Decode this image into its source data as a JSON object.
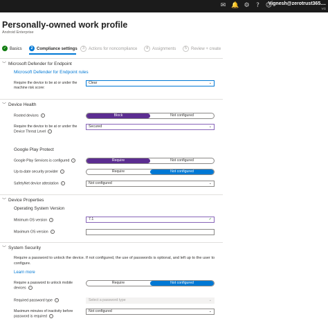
{
  "topbar": {
    "user_name": "Vignesh@zerotrust365....",
    "tenant_initials": "VG",
    "icons": [
      "mail-icon",
      "bell-icon",
      "gear-icon",
      "help-icon",
      "feedback-icon"
    ]
  },
  "page": {
    "title": "Personally-owned work profile",
    "more": "···",
    "subtitle": "Android Enterprise"
  },
  "wizard": {
    "steps": [
      {
        "num": "✓",
        "label": "Basics"
      },
      {
        "num": "2",
        "label": "Compliance settings"
      },
      {
        "num": "3",
        "label": "Actions for noncompliance"
      },
      {
        "num": "4",
        "label": "Assignments"
      },
      {
        "num": "5",
        "label": "Review + create"
      }
    ]
  },
  "mde": {
    "header": "Microsoft Defender for Endpoint",
    "rules_label": "Microsoft Defender for Endpoint rules",
    "risk_label": "Require the device to be at or under the machine risk score:",
    "risk_value": "Clear"
  },
  "health": {
    "header": "Device Health",
    "rooted_label": "Rooted devices",
    "rooted_left": "Block",
    "rooted_right": "Not configured",
    "threat_label": "Require the device to be at or under the Device Threat Level",
    "threat_value": "Secured",
    "gpp_header": "Google Play Protect",
    "gps_label": "Google Play Services is configured",
    "gps_left": "Require",
    "gps_right": "Not configured",
    "usp_label": "Up-to-date security provider",
    "usp_left": "Require",
    "usp_right": "Not configured",
    "safetynet_label": "SafetyNet device attestation",
    "safetynet_value": "Not configured"
  },
  "props": {
    "header": "Device Properties",
    "os_header": "Operating System Version",
    "min_label": "Minimum OS version",
    "min_value": "7.1",
    "max_label": "Maximum OS version",
    "max_value": ""
  },
  "security": {
    "header": "System Security",
    "desc": "Require a password to unlock the device. If not configured, the use of passwords is optional, and left up to the user to configure.",
    "learn_more": "Learn more",
    "pwd_label": "Require a password to unlock mobile devices",
    "pwd_left": "Require",
    "pwd_right": "Not configured",
    "type_label": "Required password type",
    "type_placeholder": "Select a password type",
    "inactivity_label": "Maximum minutes of inactivity before password is required",
    "inactivity_value": "Not configured"
  }
}
